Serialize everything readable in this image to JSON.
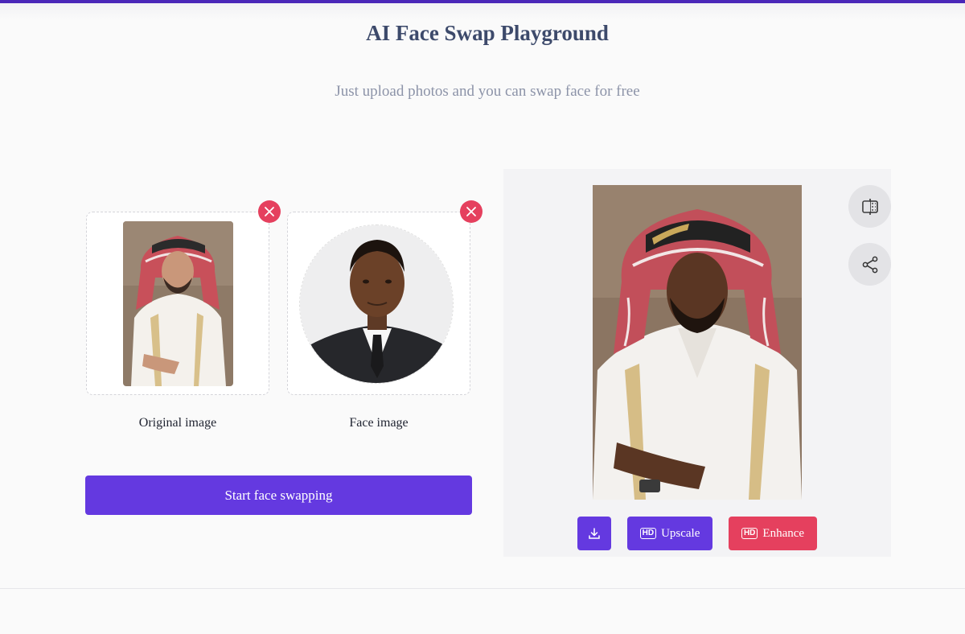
{
  "header": {
    "title": "AI Face Swap Playground",
    "subtitle": "Just upload photos and you can swap face for free"
  },
  "uploads": {
    "original_label": "Original image",
    "face_label": "Face image"
  },
  "actions": {
    "start_label": "Start face swapping",
    "upscale_label": "Upscale",
    "enhance_label": "Enhance",
    "hd_badge": "HD"
  },
  "colors": {
    "accent": "#6439e0",
    "danger": "#e5405e",
    "title": "#3d4a6b",
    "top_bar": "#4a26b8"
  },
  "icons": {
    "remove": "close-icon",
    "compare": "compare-icon",
    "share": "share-icon",
    "download": "download-icon"
  }
}
